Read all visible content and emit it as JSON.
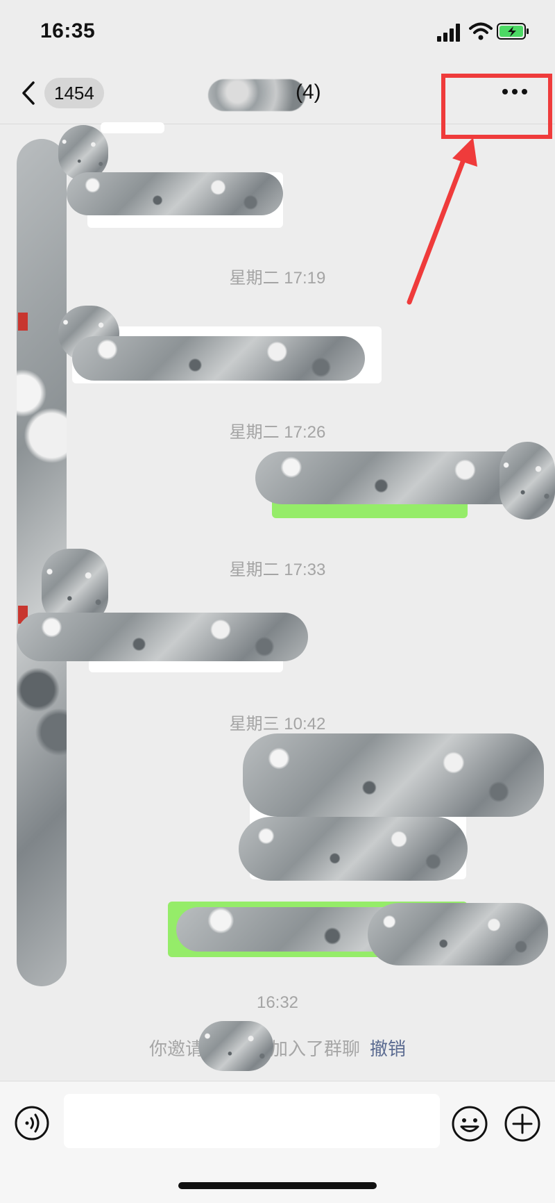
{
  "status_bar": {
    "time": "16:35"
  },
  "header": {
    "back_count": "1454",
    "title_suffix": "(4)"
  },
  "timestamps": [
    "星期二 17:19",
    "星期二 17:26",
    "星期二 17:33",
    "星期三 10:42",
    "16:32"
  ],
  "system_message": {
    "prefix": "你邀请",
    "suffix": "加入了群聊",
    "undo": "撤销"
  },
  "colors": {
    "accent_green": "#95ec69",
    "annotation_red": "#ef3b3b",
    "link": "#5b6b91"
  },
  "icons": [
    "back-icon",
    "more-icon",
    "voice-icon",
    "emoji-icon",
    "plus-icon"
  ]
}
